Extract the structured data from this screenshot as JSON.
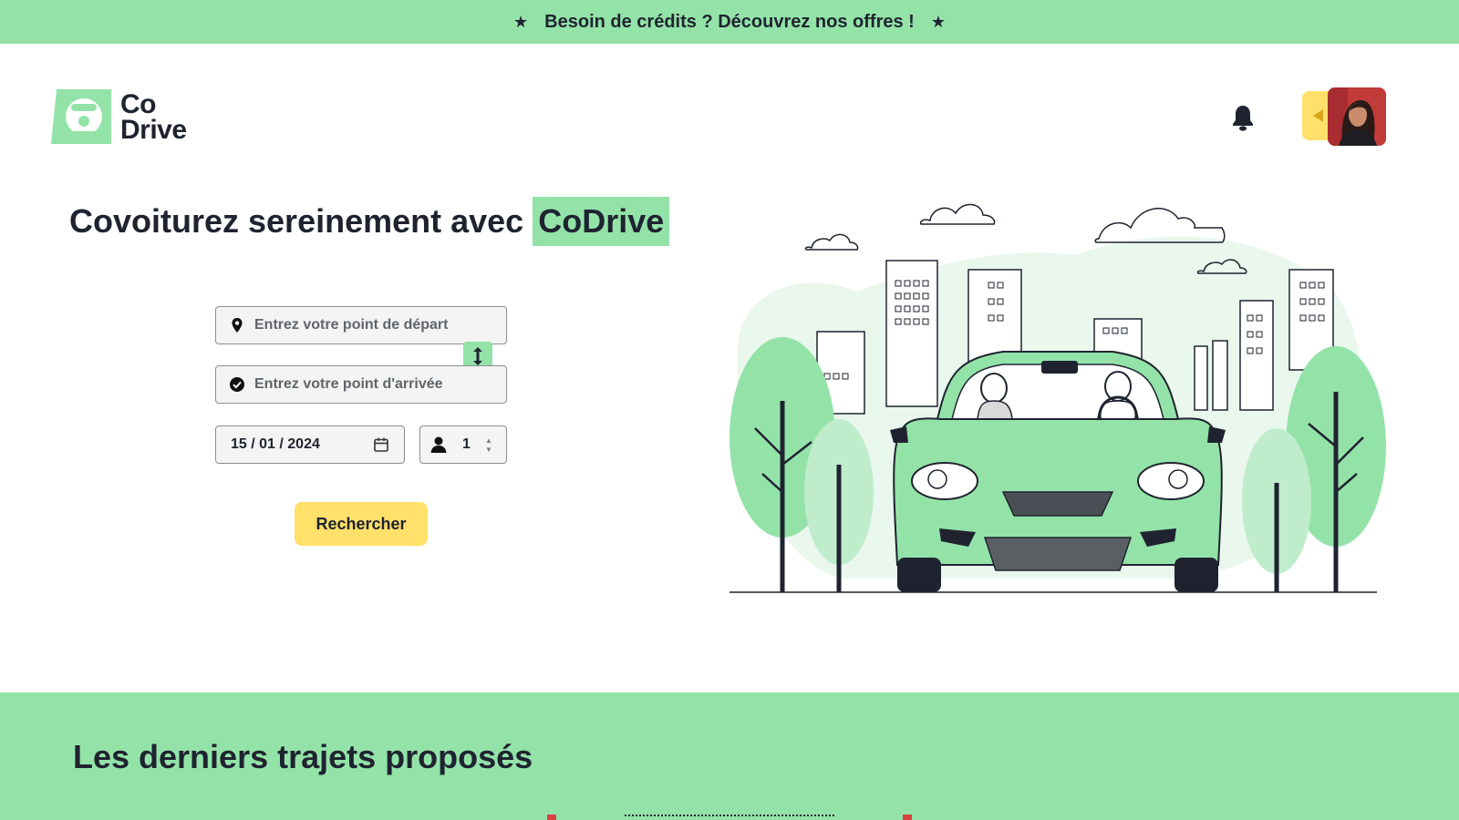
{
  "banner": {
    "text": "Besoin de crédits ? Découvrez nos offres !",
    "star": "★"
  },
  "logo": {
    "line1": "Co",
    "line2": "Drive"
  },
  "header": {
    "notifications_icon": "bell-icon",
    "profile_toggle_icon": "caret-left-icon"
  },
  "hero": {
    "title_prefix": "Covoiturez sereinement avec",
    "title_highlight": "CoDrive"
  },
  "search": {
    "departure_placeholder": "Entrez votre point de départ",
    "arrival_placeholder": "Entrez votre point d'arrivée",
    "date_value": "15 / 01 / 2024",
    "passengers_value": "1",
    "submit_label": "Rechercher"
  },
  "latest": {
    "title": "Les derniers trajets proposés"
  },
  "colors": {
    "accent_green": "#93e3a8",
    "accent_yellow": "#ffe06a",
    "text_dark": "#1f2330"
  }
}
